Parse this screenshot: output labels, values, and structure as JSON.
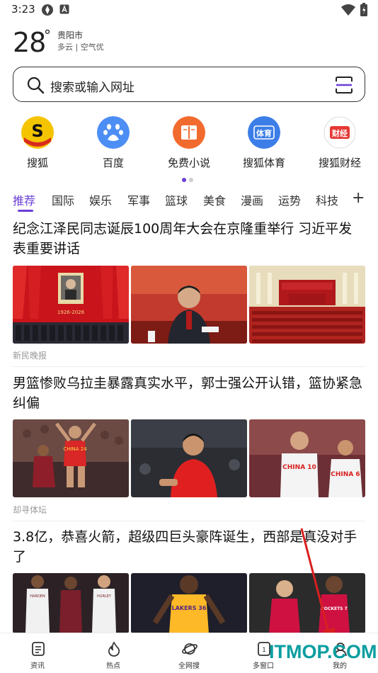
{
  "status_bar": {
    "time": "3:23"
  },
  "weather": {
    "temperature": "28",
    "degree": "°",
    "city": "贵阳市",
    "condition": "多云 | 空气优"
  },
  "search": {
    "placeholder": "搜索或输入网址"
  },
  "quick_links": [
    {
      "label": "搜狐",
      "icon": "sohu-logo-icon",
      "color": "#f5c400"
    },
    {
      "label": "百度",
      "icon": "baidu-paw-icon",
      "color": "#4d8ef5"
    },
    {
      "label": "免费小说",
      "icon": "book-icon",
      "color": "#f26b2e"
    },
    {
      "label": "搜狐体育",
      "icon": "sports-icon",
      "color": "#3c7ee8"
    },
    {
      "label": "搜狐财经",
      "icon": "finance-icon",
      "color": "#e53935"
    }
  ],
  "quick_link_icon_text": {
    "sports": "体育",
    "finance": "财经"
  },
  "tabs": [
    "推荐",
    "国际",
    "娱乐",
    "军事",
    "篮球",
    "美食",
    "漫画",
    "运势",
    "科技"
  ],
  "tab_add": "+",
  "news": [
    {
      "title": "纪念江泽民同志诞辰100周年大会在京隆重举行 习近平发表重要讲话",
      "source": "新民晚报",
      "image_caption": "1926-2026"
    },
    {
      "title": "男篮惨败乌拉圭暴露真实水平，郭士强公开认错，篮协紧急纠偏",
      "source": "却寻体坛",
      "jersey_text": [
        "CHINA 24",
        "CHINA 10",
        "CHINA 6"
      ]
    },
    {
      "title": "3.8亿，恭喜火箭，超级四巨头豪阵诞生，西部是真没对手了",
      "source": "",
      "jersey_text": [
        "HARDEN",
        "HURLEY",
        "LAKERS 36",
        "ROCKETS 7"
      ]
    }
  ],
  "bottom_nav": [
    {
      "label": "资讯",
      "icon": "news-icon"
    },
    {
      "label": "热点",
      "icon": "flame-icon"
    },
    {
      "label": "全网搜",
      "icon": "planet-icon"
    },
    {
      "label": "多窗口",
      "icon": "windows-icon",
      "badge": "1"
    },
    {
      "label": "我的",
      "icon": "user-icon"
    }
  ],
  "watermark": "ITMOP.COM",
  "colors": {
    "accent": "#6a3fd6",
    "arrow": "#d91f1f",
    "watermark": "#0a9ea0"
  }
}
